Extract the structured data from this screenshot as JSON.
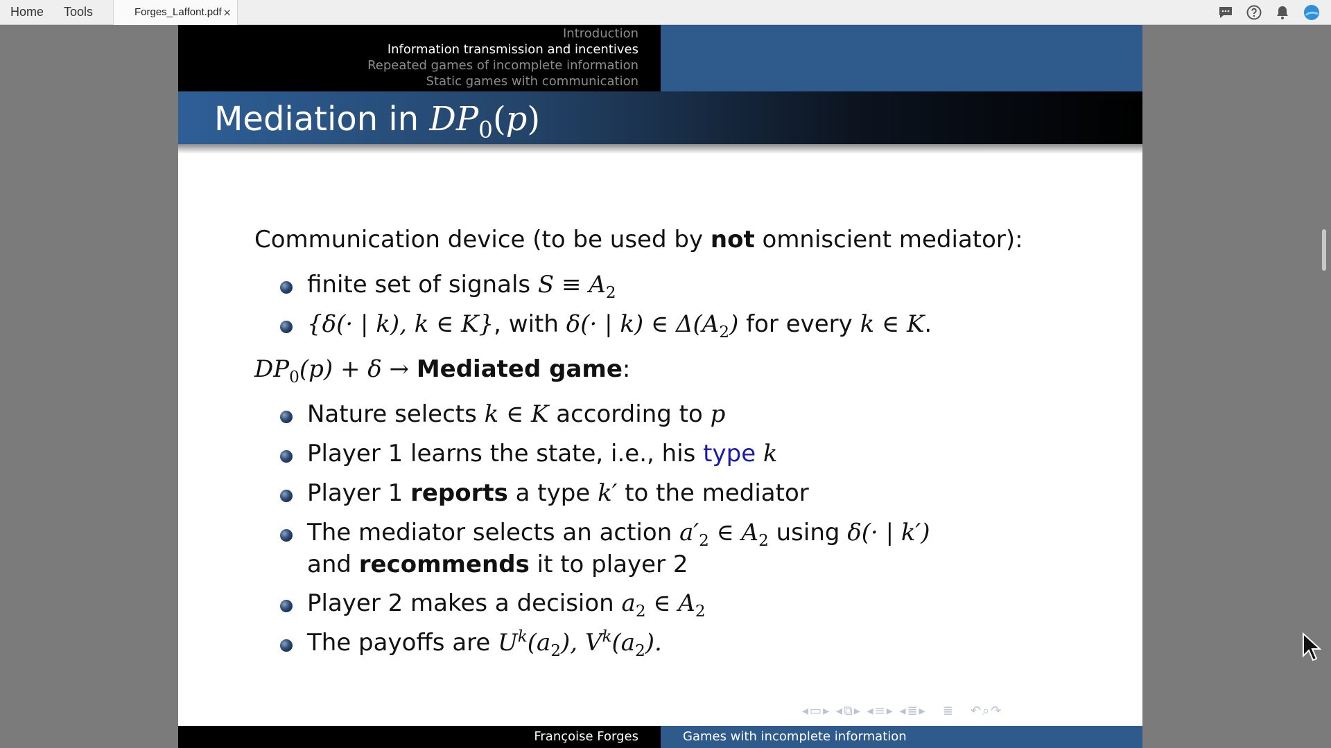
{
  "topbar": {
    "home": "Home",
    "tools": "Tools",
    "tab_label": "Forges_Laffont.pdf",
    "tab_close": "×"
  },
  "header": {
    "sections": [
      "Introduction",
      "Information transmission and incentives",
      "Repeated games of incomplete information",
      "Static games with communication"
    ],
    "active_section_index": 1
  },
  "slide": {
    "title_text": "Mediation in ",
    "title_math": "DP",
    "title_sub": "0",
    "title_arg": "(p)",
    "intro_a": "Communication device (to be used by ",
    "intro_bold": "not",
    "intro_b": " omniscient mediator):",
    "b1_text": "finite set of signals ",
    "b1_math": "S ≡ A",
    "b1_sub": "2",
    "b2_a": "{δ(· | k), k ∈ K}",
    "b2_b": ", with ",
    "b2_c": "δ(· | k) ∈ Δ(A",
    "b2_sub": "2",
    "b2_d": ")",
    "b2_e": " for every ",
    "b2_f": "k ∈ K",
    "b2_g": ".",
    "dp_math": "DP",
    "dp_sub": "0",
    "dp_rest": "(p) + δ → ",
    "dp_bold": "Mediated game",
    "dp_colon": ":",
    "m1_a": "Nature selects ",
    "m1_b": "k ∈ K",
    "m1_c": " according to ",
    "m1_d": "p",
    "m2_a": "Player 1 learns the state, i.e., his ",
    "m2_type": "type",
    "m2_k": " k",
    "m3_a": "Player 1 ",
    "m3_bold": "reports",
    "m3_b": " a type ",
    "m3_k": "k′",
    "m3_c": " to the mediator",
    "m4_a": "The mediator selects an action ",
    "m4_m": "a′",
    "m4_sub": "2",
    "m4_in": " ∈ A",
    "m4_sub2": "2",
    "m4_using": " using ",
    "m4_delta": "δ(· | k′)",
    "m4_line2a": "and ",
    "m4_bold": "recommends",
    "m4_line2b": " it to player 2",
    "m5_a": "Player 2 makes a decision ",
    "m5_m": "a",
    "m5_sub": "2",
    "m5_in": " ∈ A",
    "m5_sub2": "2",
    "m6_a": "The payoffs are ",
    "m6_U": "U",
    "m6_k1": "k",
    "m6_arg1": "(a",
    "m6_s1": "2",
    "m6_c1": "), ",
    "m6_V": "V",
    "m6_k2": "k",
    "m6_arg2": "(a",
    "m6_s2": "2",
    "m6_c2": ")."
  },
  "footer": {
    "author": "Françoise Forges",
    "title": "Games with incomplete information"
  },
  "colors": {
    "accent_blue": "#2f5b8c",
    "link_blue": "#1a1aad"
  },
  "icons": [
    "comment-icon",
    "help-icon",
    "bell-icon",
    "profile-icon",
    "close-icon",
    "cursor-icon"
  ]
}
